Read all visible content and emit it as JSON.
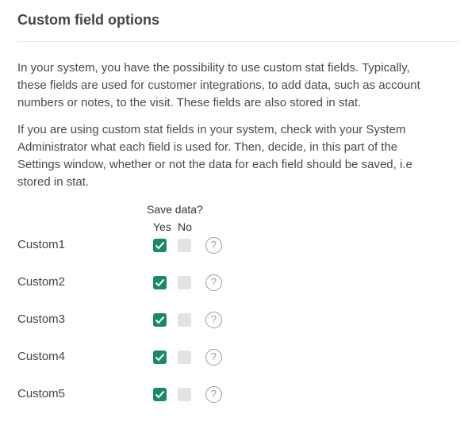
{
  "header": {
    "title": "Custom field options"
  },
  "description": {
    "p1": "In your system, you have the possibility to use custom stat fields. Typically, these fields are used for customer integrations, to add data, such as account numbers or notes, to the visit. These fields are also stored in stat.",
    "p2": "If you are using custom stat fields in your system, check with your System Administrator what each field is used for. Then, decide, in this part of the Settings window, whether or not the data for each field should be saved, i.e stored in stat."
  },
  "table": {
    "group_label": "Save data?",
    "yes_label": "Yes",
    "no_label": "No",
    "help_glyph": "?",
    "rows": [
      {
        "label": "Custom1",
        "yes": true,
        "no": false
      },
      {
        "label": "Custom2",
        "yes": true,
        "no": false
      },
      {
        "label": "Custom3",
        "yes": true,
        "no": false
      },
      {
        "label": "Custom4",
        "yes": true,
        "no": false
      },
      {
        "label": "Custom5",
        "yes": true,
        "no": false
      }
    ]
  },
  "colors": {
    "accent": "#1b8a63",
    "unchecked": "#e3e3e3",
    "help": "#9a9a9a"
  }
}
